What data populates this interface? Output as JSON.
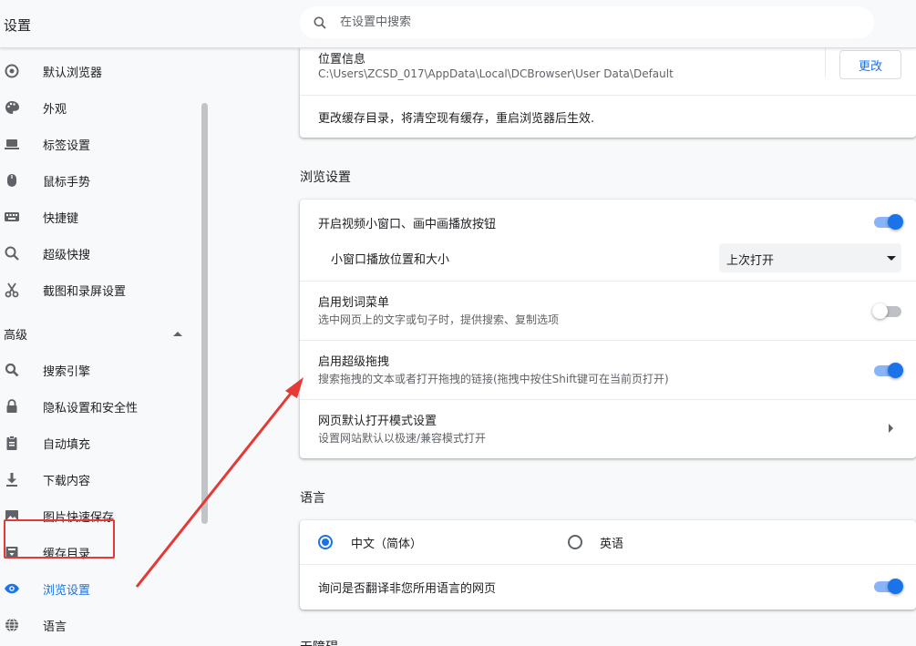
{
  "header": {
    "title": "设置",
    "search_placeholder": "在设置中搜索"
  },
  "sidebar": {
    "items": [
      {
        "label": "默认浏览器",
        "icon": "browser-icon"
      },
      {
        "label": "外观",
        "icon": "palette-icon"
      },
      {
        "label": "标签设置",
        "icon": "laptop-icon"
      },
      {
        "label": "鼠标手势",
        "icon": "mouse-icon"
      },
      {
        "label": "快捷键",
        "icon": "keyboard-icon"
      },
      {
        "label": "超级快搜",
        "icon": "search-icon"
      },
      {
        "label": "截图和录屏设置",
        "icon": "scissors-icon"
      }
    ],
    "advanced_label": "高级",
    "advanced_items": [
      {
        "label": "搜索引擎",
        "icon": "search-icon"
      },
      {
        "label": "隐私设置和安全性",
        "icon": "lock-icon"
      },
      {
        "label": "自动填充",
        "icon": "clipboard-icon"
      },
      {
        "label": "下载内容",
        "icon": "download-icon"
      },
      {
        "label": "图片快速保存",
        "icon": "image-icon"
      },
      {
        "label": "缓存目录",
        "icon": "archive-icon"
      },
      {
        "label": "浏览设置",
        "icon": "eye-icon",
        "active": true
      },
      {
        "label": "语言",
        "icon": "globe-icon"
      }
    ]
  },
  "cache": {
    "location_title": "位置信息",
    "location_path": "C:\\Users\\ZCSD_017\\AppData\\Local\\DCBrowser\\User Data\\Default",
    "change_label": "更改",
    "note": "更改缓存目录，将清空现有缓存，重启浏览器后生效."
  },
  "browse": {
    "section_title": "浏览设置",
    "pip_label": "开启视频小窗口、画中画播放按钮",
    "pip_on": true,
    "pip_size_label": "小窗口播放位置和大小",
    "pip_size_value": "上次打开",
    "word_menu_label": "启用划词菜单",
    "word_menu_desc": "选中网页上的文字或句子时，提供搜索、复制选项",
    "word_menu_on": false,
    "drag_label": "启用超级拖拽",
    "drag_desc": "搜索拖拽的文本或者打开拖拽的链接(拖拽中按住Shift键可在当前页打开)",
    "drag_on": true,
    "open_mode_label": "网页默认打开模式设置",
    "open_mode_desc": "设置网站默认以极速/兼容模式打开"
  },
  "language": {
    "section_title": "语言",
    "option_zh": "中文（简体）",
    "option_en": "英语",
    "selected": "zh",
    "translate_label": "询问是否翻译非您所用语言的网页",
    "translate_on": true
  },
  "next_section_title": "无障碍",
  "colors": {
    "accent": "#1a73e8",
    "annotation": "#e53935"
  }
}
